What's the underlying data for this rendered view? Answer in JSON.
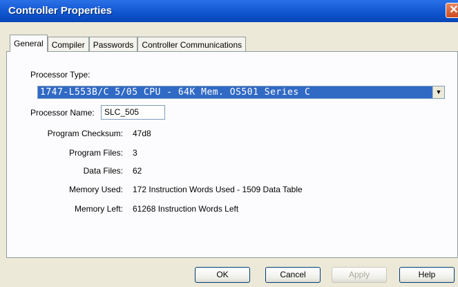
{
  "window": {
    "title": "Controller Properties",
    "close_glyph": "✕"
  },
  "tabs": [
    {
      "label": "General",
      "active": true
    },
    {
      "label": "Compiler",
      "active": false
    },
    {
      "label": "Passwords",
      "active": false
    },
    {
      "label": "Controller Communications",
      "active": false
    }
  ],
  "general": {
    "processor_type_label": "Processor Type:",
    "processor_type_value": "1747-L553B/C 5/05 CPU - 64K Mem. OS501 Series C",
    "dropdown_arrow": "▼",
    "processor_name_label": "Processor Name:",
    "processor_name_value": "SLC_505",
    "fields": [
      {
        "label": "Program Checksum:",
        "value": "47d8"
      },
      {
        "label": "Program Files:",
        "value": "3"
      },
      {
        "label": "Data Files:",
        "value": "62"
      },
      {
        "label": "Memory Used:",
        "value": "172 Instruction Words Used - 1509 Data Table"
      },
      {
        "label": "Memory Left:",
        "value": "61268 Instruction Words Left"
      }
    ]
  },
  "buttons": {
    "ok": "OK",
    "cancel": "Cancel",
    "apply": "Apply",
    "help": "Help"
  }
}
